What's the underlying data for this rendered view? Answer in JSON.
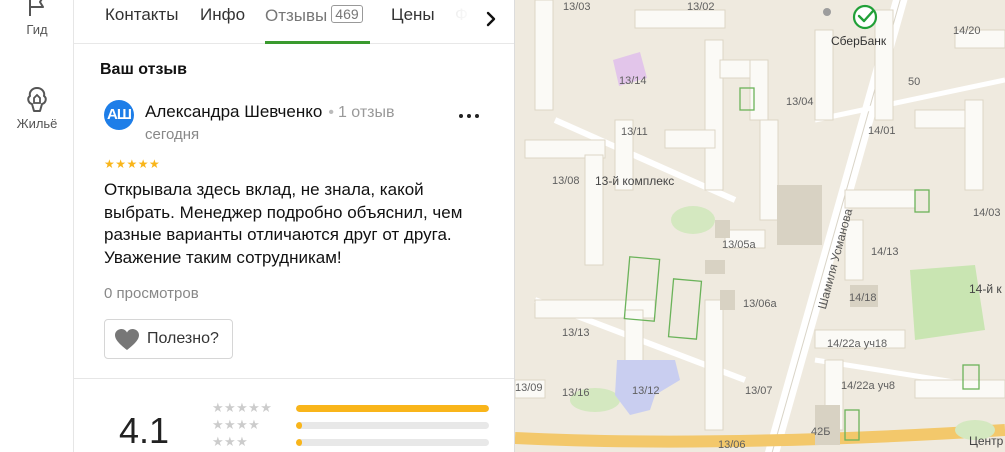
{
  "rail": {
    "items": [
      {
        "label": "Гид"
      },
      {
        "label": "Жильё"
      }
    ]
  },
  "tabs": {
    "items": [
      {
        "label": "Контакты"
      },
      {
        "label": "Инфо"
      },
      {
        "label": "Отзывы",
        "count": "469"
      },
      {
        "label": "Цены"
      },
      {
        "label": "Ф"
      }
    ]
  },
  "review": {
    "section_title": "Ваш отзыв",
    "avatar_initials": "АШ",
    "author": "Александра Шевченко",
    "author_reviews": "1 отзыв",
    "date": "сегодня",
    "rating": 5,
    "stars": "★★★★★",
    "text": "Открывала здесь вклад, не знала, какой выбрать. Менеджер подробно объяснил, чем разные варианты отличаются друг от друга. Уважение таким сотрудникам!",
    "views": "0 просмотров",
    "helpful_label": "Полезно?"
  },
  "rating_summary": {
    "average": "4.1",
    "rows": [
      {
        "stars": "★★★★★",
        "fraction": 1.0
      },
      {
        "stars": "★★★★",
        "fraction": 0.03
      },
      {
        "stars": "★★★",
        "fraction": 0.03
      }
    ]
  },
  "map": {
    "labels": [
      "13/03",
      "13/02",
      "13/14",
      "13/04",
      "13/11",
      "13/08",
      "13-й комплекс",
      "13/05а",
      "13/06а",
      "13/13",
      "13/09",
      "13/16",
      "13/12",
      "13/07",
      "13/06",
      "14/20",
      "50",
      "14/01",
      "14/03",
      "14/13",
      "14/18",
      "14-й к",
      "14/22а уч18",
      "14/22а уч8",
      "42Б",
      "Центр"
    ],
    "street": "Шамиля Усманова",
    "poi_name": "СберБанк",
    "colors": {
      "sber": "#21a038",
      "bg": "#efeadf",
      "building": "#fbfaf6",
      "park": "#c9e5b2",
      "road": "#f3c86b"
    }
  }
}
